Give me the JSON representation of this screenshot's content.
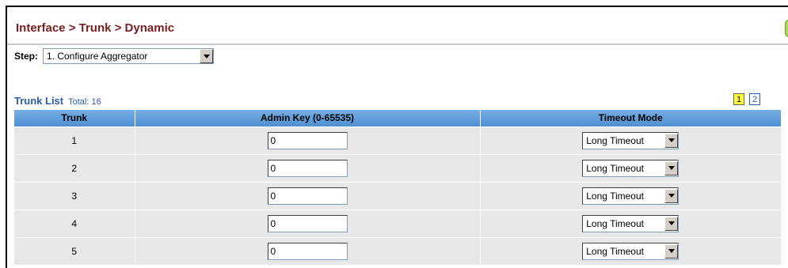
{
  "header": {
    "title": "Interface > Trunk > Dynamic"
  },
  "step": {
    "label": "Step:",
    "selected": "1. Configure Aggregator"
  },
  "trunk_list": {
    "title": "Trunk List",
    "total": "Total: 16",
    "pages": [
      "1",
      "2"
    ],
    "active_page": "1",
    "columns": [
      "Trunk",
      "Admin Key (0-65535)",
      "Timeout Mode"
    ],
    "rows": [
      {
        "trunk": "1",
        "admin_key": "0",
        "timeout_mode": "Long Timeout"
      },
      {
        "trunk": "2",
        "admin_key": "0",
        "timeout_mode": "Long Timeout"
      },
      {
        "trunk": "3",
        "admin_key": "0",
        "timeout_mode": "Long Timeout"
      },
      {
        "trunk": "4",
        "admin_key": "0",
        "timeout_mode": "Long Timeout"
      },
      {
        "trunk": "5",
        "admin_key": "0",
        "timeout_mode": "Long Timeout"
      }
    ]
  },
  "colors": {
    "title": "#7a1f1f",
    "link": "#2a5ca8",
    "header_bg": "#5b9bd5",
    "row_bg": "#e8e8e8",
    "active_page_bg": "#ffff33"
  }
}
